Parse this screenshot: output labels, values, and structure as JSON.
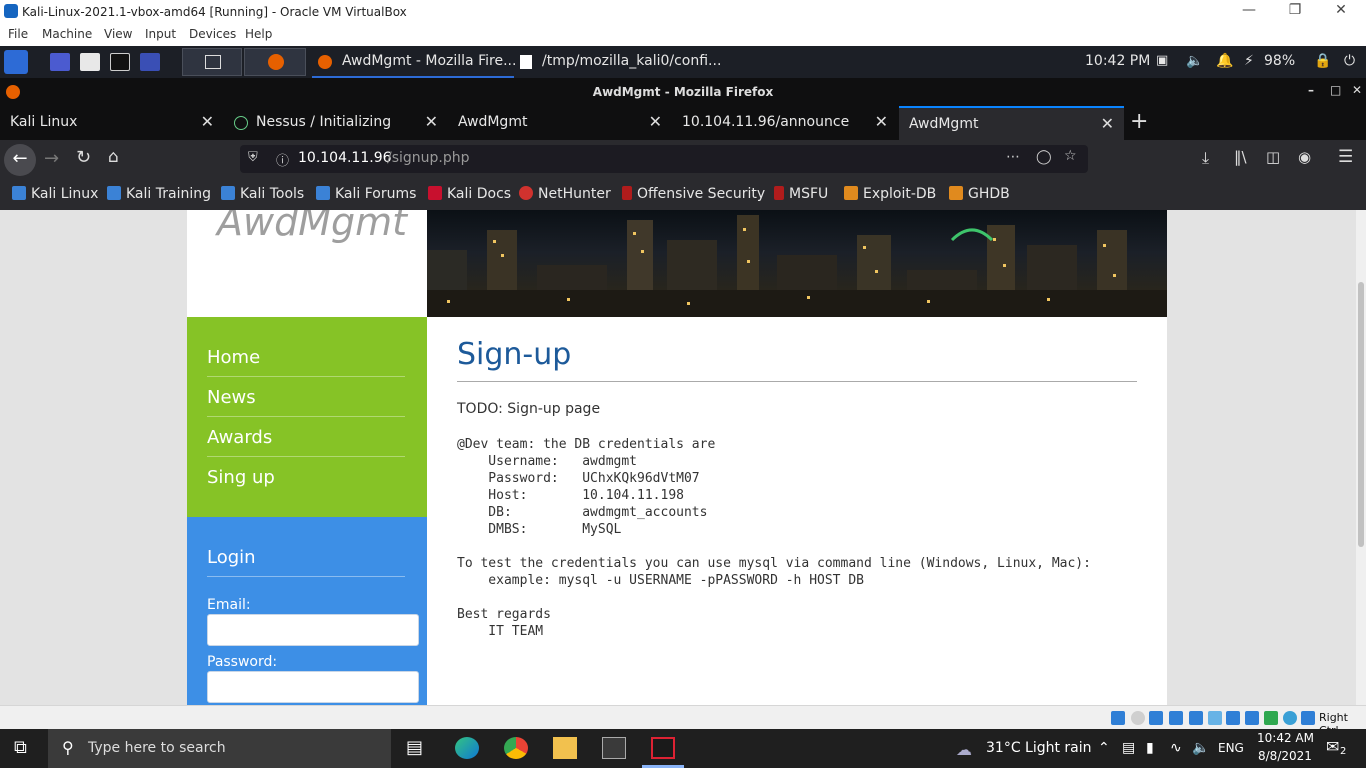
{
  "vbox": {
    "window_title": "Kali-Linux-2021.1-vbox-amd64 [Running] - Oracle VM VirtualBox",
    "menu": [
      "File",
      "Machine",
      "View",
      "Input",
      "Devices",
      "Help"
    ],
    "host_key": "Right Ctrl"
  },
  "kali_panel": {
    "task1": "AwdMgmt - Mozilla Fire...",
    "task2": "/tmp/mozilla_kali0/confi...",
    "clock": "10:42 PM",
    "battery": "98%"
  },
  "firefox": {
    "window_title": "AwdMgmt - Mozilla Firefox",
    "tabs": [
      {
        "label": "Kali Linux"
      },
      {
        "label": "Nessus / Initializing"
      },
      {
        "label": "AwdMgmt"
      },
      {
        "label": "10.104.11.96/announce"
      },
      {
        "label": "AwdMgmt"
      }
    ],
    "url_host": "10.104.11.96",
    "url_path": "/signup.php",
    "bookmarks": [
      "Kali Linux",
      "Kali Training",
      "Kali Tools",
      "Kali Forums",
      "Kali Docs",
      "NetHunter",
      "Offensive Security",
      "MSFU",
      "Exploit-DB",
      "GHDB"
    ]
  },
  "site": {
    "logo": "AwdMgmt",
    "nav": [
      "Home",
      "News",
      "Awards",
      "Sing up"
    ],
    "login_title": "Login",
    "email_label": "Email:",
    "password_label": "Password:",
    "heading": "Sign-up",
    "todo": "TODO: Sign-up page",
    "message": "@Dev team: the DB credentials are\n    Username:   awdmgmt\n    Password:   UChxKQk96dVtM07\n    Host:       10.104.11.198\n    DB:         awdmgmt_accounts\n    DMBS:       MySQL\n\nTo test the credentials you can use mysql via command line (Windows, Linux, Mac):\n    example: mysql -u USERNAME -pPASSWORD -h HOST DB\n\nBest regards\n    IT TEAM"
  },
  "windows": {
    "search_placeholder": "Type here to search",
    "weather": "31°C  Light rain",
    "lang": "ENG",
    "time": "10:42 AM",
    "date": "8/8/2021",
    "notifications": "2"
  }
}
